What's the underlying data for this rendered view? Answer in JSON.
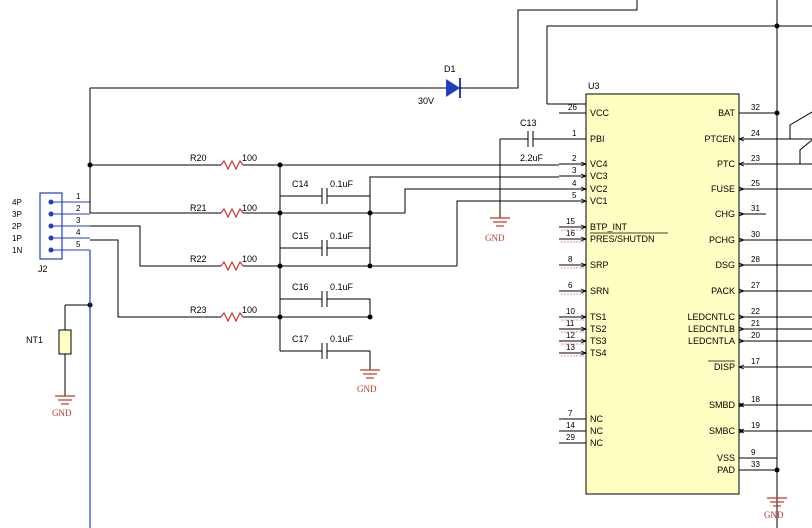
{
  "diode": {
    "ref": "D1",
    "value": "30V"
  },
  "ic": {
    "ref": "U3",
    "left_pins": [
      {
        "num": "26",
        "name": "VCC"
      },
      {
        "num": "1",
        "name": "PBI"
      },
      {
        "num": "2",
        "name": "VC4"
      },
      {
        "num": "3",
        "name": "VC3"
      },
      {
        "num": "4",
        "name": "VC2"
      },
      {
        "num": "5",
        "name": "VC1"
      },
      {
        "num": "15",
        "name": "BTP_INT"
      },
      {
        "num": "16",
        "name": "PRES/SHUTDN"
      },
      {
        "num": "8",
        "name": "SRP"
      },
      {
        "num": "6",
        "name": "SRN"
      },
      {
        "num": "10",
        "name": "TS1"
      },
      {
        "num": "11",
        "name": "TS2"
      },
      {
        "num": "12",
        "name": "TS3"
      },
      {
        "num": "13",
        "name": "TS4"
      },
      {
        "num": "7",
        "name": "NC"
      },
      {
        "num": "14",
        "name": "NC"
      },
      {
        "num": "29",
        "name": "NC"
      }
    ],
    "right_pins": [
      {
        "num": "32",
        "name": "BAT"
      },
      {
        "num": "24",
        "name": "PTCEN"
      },
      {
        "num": "23",
        "name": "PTC"
      },
      {
        "num": "25",
        "name": "FUSE"
      },
      {
        "num": "31",
        "name": "CHG"
      },
      {
        "num": "30",
        "name": "PCHG"
      },
      {
        "num": "28",
        "name": "DSG"
      },
      {
        "num": "27",
        "name": "PACK"
      },
      {
        "num": "22",
        "name": "LEDCNTLC"
      },
      {
        "num": "21",
        "name": "LEDCNTLB"
      },
      {
        "num": "20",
        "name": "LEDCNTLA"
      },
      {
        "num": "17",
        "name": "DISP"
      },
      {
        "num": "18",
        "name": "SMBD"
      },
      {
        "num": "19",
        "name": "SMBC"
      },
      {
        "num": "9",
        "name": "VSS"
      },
      {
        "num": "33",
        "name": "PAD"
      }
    ]
  },
  "resistors": [
    {
      "ref": "R20",
      "value": "100"
    },
    {
      "ref": "R21",
      "value": "100"
    },
    {
      "ref": "R22",
      "value": "100"
    },
    {
      "ref": "R23",
      "value": "100"
    }
  ],
  "capacitors": [
    {
      "ref": "C13",
      "value": "2.2uF"
    },
    {
      "ref": "C14",
      "value": "0.1uF"
    },
    {
      "ref": "C15",
      "value": "0.1uF"
    },
    {
      "ref": "C16",
      "value": "0.1uF"
    },
    {
      "ref": "C17",
      "value": "0.1uF"
    }
  ],
  "connector": {
    "ref": "J2",
    "pins": [
      {
        "num": "1",
        "label": "4P"
      },
      {
        "num": "2",
        "label": "3P"
      },
      {
        "num": "3",
        "label": "2P"
      },
      {
        "num": "4",
        "label": "1P"
      },
      {
        "num": "5",
        "label": "1N"
      }
    ]
  },
  "thermistor": {
    "ref": "NT1"
  },
  "ground_label": "GND"
}
